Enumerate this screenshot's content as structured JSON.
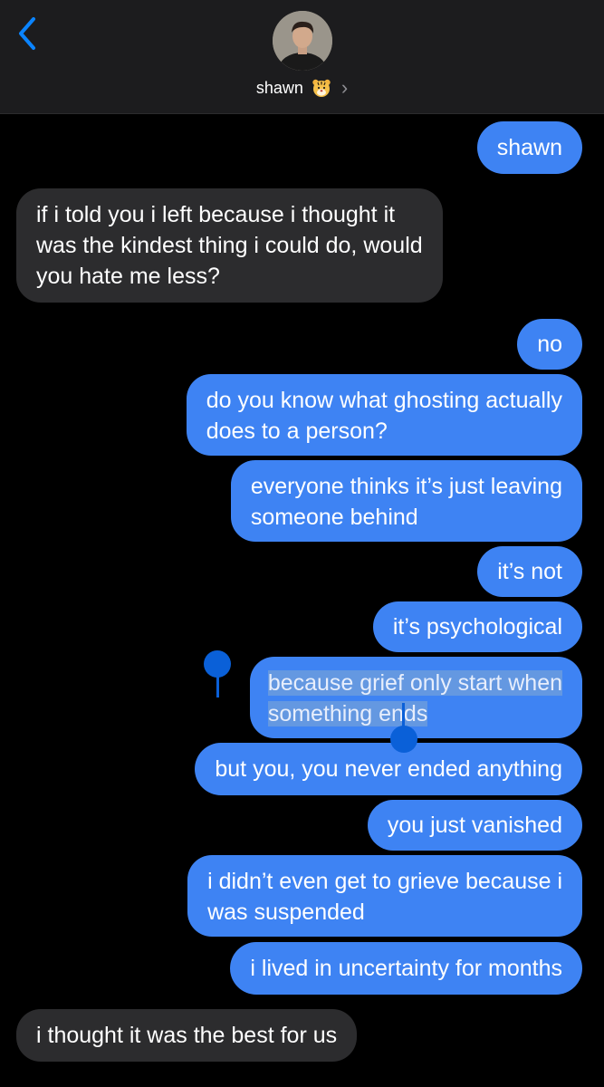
{
  "header": {
    "contact_name": "shawn",
    "back_icon": "chevron-left-icon",
    "avatar_icon": "contact-avatar",
    "badge_icon": "tiger-emoji-icon",
    "chevron": "›"
  },
  "colors": {
    "sent_bubble": "#3e83f3",
    "received_bubble": "#2c2c2e",
    "background": "#000000",
    "header_bg": "#1c1c1e",
    "accent": "#0a84ff"
  },
  "messages": [
    {
      "from": "me",
      "lines": [
        "shawn"
      ]
    },
    {
      "from": "them",
      "lines": [
        "if i told you i left because i thought it",
        "was the kindest thing i could do, would",
        "you hate me less?"
      ]
    },
    {
      "from": "me",
      "lines": [
        "no"
      ]
    },
    {
      "from": "me",
      "lines": [
        "do you know what ghosting actually",
        "does to a person?"
      ]
    },
    {
      "from": "me",
      "lines": [
        "everyone thinks it’s just leaving",
        "someone behind"
      ]
    },
    {
      "from": "me",
      "lines": [
        "it’s not"
      ]
    },
    {
      "from": "me",
      "lines": [
        "it’s psychological"
      ]
    },
    {
      "from": "me",
      "lines": [
        "because grief only start when",
        "something ends"
      ],
      "selected": true
    },
    {
      "from": "me",
      "lines": [
        "but you, you never ended anything"
      ]
    },
    {
      "from": "me",
      "lines": [
        "you just vanished"
      ]
    },
    {
      "from": "me",
      "lines": [
        "i didn’t even get to grieve because i",
        "was suspended"
      ]
    },
    {
      "from": "me",
      "lines": [
        "i lived in uncertainty for months"
      ]
    },
    {
      "from": "them",
      "lines": [
        "i thought it was the best for us"
      ]
    }
  ]
}
